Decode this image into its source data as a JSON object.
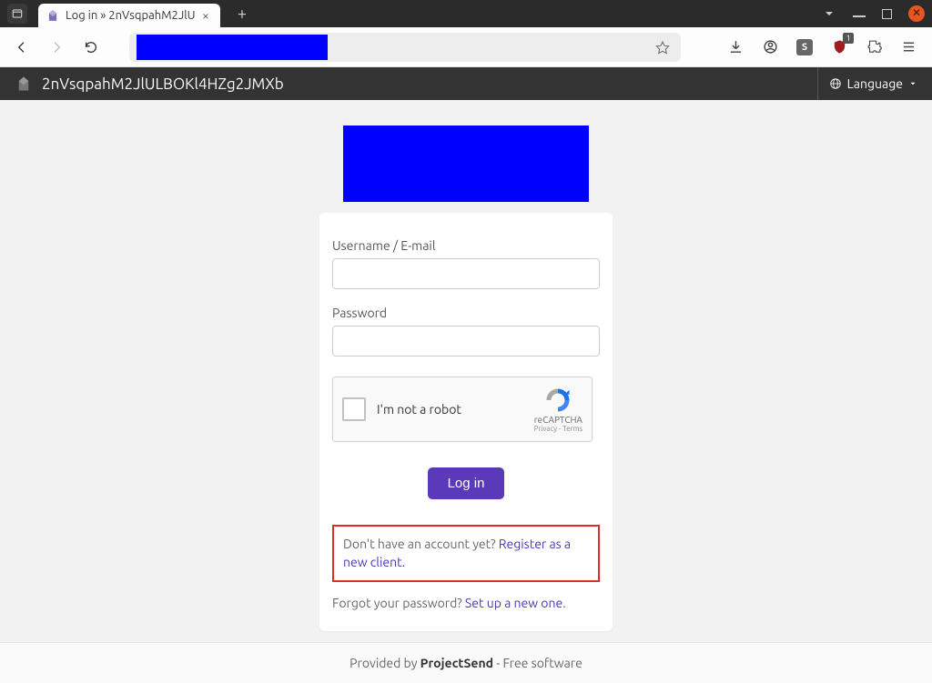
{
  "window": {
    "tab_title": "Log in » 2nVsqpahM2JlU",
    "tab_close": "×",
    "new_tab": "+"
  },
  "app_header": {
    "title": "2nVsqpahM2JlULBOKl4HZg2JMXb",
    "language_label": "Language"
  },
  "login": {
    "username_label": "Username / E-mail",
    "password_label": "Password",
    "recaptcha_label": "I'm not a robot",
    "recaptcha_brand": "reCAPTCHA",
    "recaptcha_links": "Privacy - Terms",
    "submit_label": "Log in",
    "register_prompt": "Don't have an account yet? ",
    "register_link": "Register as a new client.",
    "forgot_prompt": "Forgot your password? ",
    "forgot_link": "Set up a new one."
  },
  "footer": {
    "prefix": "Provided by ",
    "brand": "ProjectSend",
    "suffix": " - Free software"
  },
  "ext": {
    "s": "S",
    "badge": "1"
  }
}
